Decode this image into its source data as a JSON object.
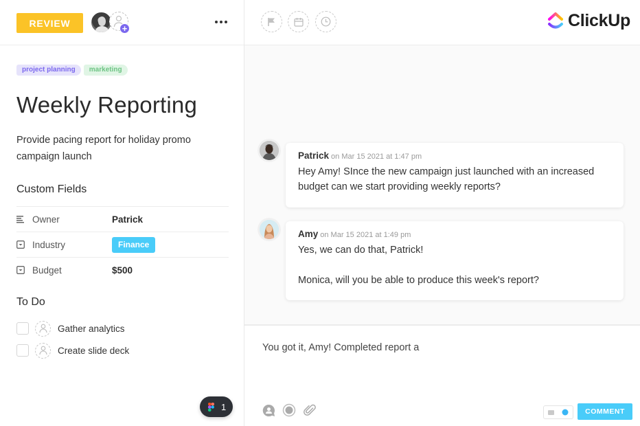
{
  "task": {
    "status_label": "REVIEW",
    "status_color": "#fbc327",
    "tags": [
      {
        "label": "project planning",
        "color": "#7b68ee"
      },
      {
        "label": "marketing",
        "color": "#6cc383"
      }
    ],
    "title": "Weekly Reporting",
    "description": "Provide pacing report for holiday promo campaign launch"
  },
  "custom_fields": {
    "heading": "Custom Fields",
    "rows": [
      {
        "icon": "text-lines-icon",
        "label": "Owner",
        "value": "Patrick"
      },
      {
        "icon": "dropdown-icon",
        "label": "Industry",
        "value": "Finance",
        "value_color": "#49ccf9"
      },
      {
        "icon": "dropdown-icon",
        "label": "Budget",
        "value": "$500"
      }
    ]
  },
  "todo": {
    "heading": "To Do",
    "items": [
      {
        "label": "Gather analytics",
        "checked": false
      },
      {
        "label": "Create slide deck",
        "checked": false
      }
    ]
  },
  "figma_badge": {
    "count": "1"
  },
  "header_icons": [
    "flag-icon",
    "calendar-icon",
    "clock-icon"
  ],
  "brand": {
    "name": "ClickUp"
  },
  "comments": [
    {
      "author": "Patrick",
      "timestamp": "on Mar 15 2021 at 1:47 pm",
      "body": [
        "Hey Amy! SInce the new campaign just launched with an increased budget can we start providing weekly reports?"
      ]
    },
    {
      "author": "Amy",
      "timestamp": "on Mar 15 2021 at 1:49 pm",
      "body": [
        "Yes, we can do that, Patrick!",
        "Monica, will you be able to produce this week's report?"
      ]
    }
  ],
  "composer": {
    "draft": "You got it, Amy! Completed report a",
    "submit_label": "COMMENT",
    "accent": "#49ccf9"
  }
}
